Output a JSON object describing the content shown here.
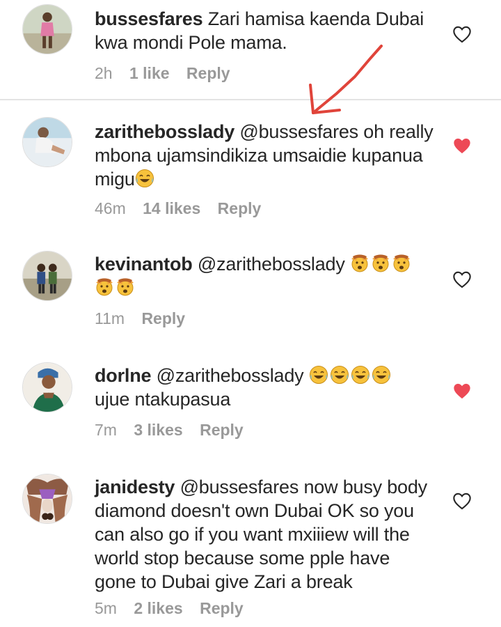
{
  "comments": [
    {
      "username": "bussesfares",
      "mention": "",
      "text": "Zari hamisa kaenda Dubai kwa mondi Pole mama.",
      "time": "2h",
      "likes": "1 like",
      "reply": "Reply",
      "liked": false
    },
    {
      "username": "zarithebosslady",
      "mention": "@bussesfares",
      "text": "oh really mbona ujamsindikiza umsaidie kupanua migu",
      "time": "46m",
      "likes": "14 likes",
      "reply": "Reply",
      "liked": true
    },
    {
      "username": "kevinantob",
      "mention": "@zarithebosslady",
      "text": "",
      "time": "11m",
      "likes": "",
      "reply": "Reply",
      "liked": false
    },
    {
      "username": "dorlne",
      "mention": "@zarithebosslady",
      "text": "ujue ntakupasua",
      "time": "7m",
      "likes": "3 likes",
      "reply": "Reply",
      "liked": true
    },
    {
      "username": "janidesty",
      "mention": "@bussesfares",
      "text": "now busy body diamond doesn't own Dubai OK so you can also go if you want mxiiiew will the world stop because some pple have gone to Dubai give Zari a break",
      "time": "5m",
      "likes": "2 likes",
      "reply": "Reply",
      "liked": false
    }
  ],
  "colors": {
    "heart_liked": "#ed4956",
    "meta_text": "#999999",
    "arrow": "#e0443a"
  },
  "icons": {
    "heart": "heart-icon",
    "laugh_emoji": "face-with-tears-of-joy-emoji",
    "hands_emoji": "face-with-hands-emoji"
  }
}
